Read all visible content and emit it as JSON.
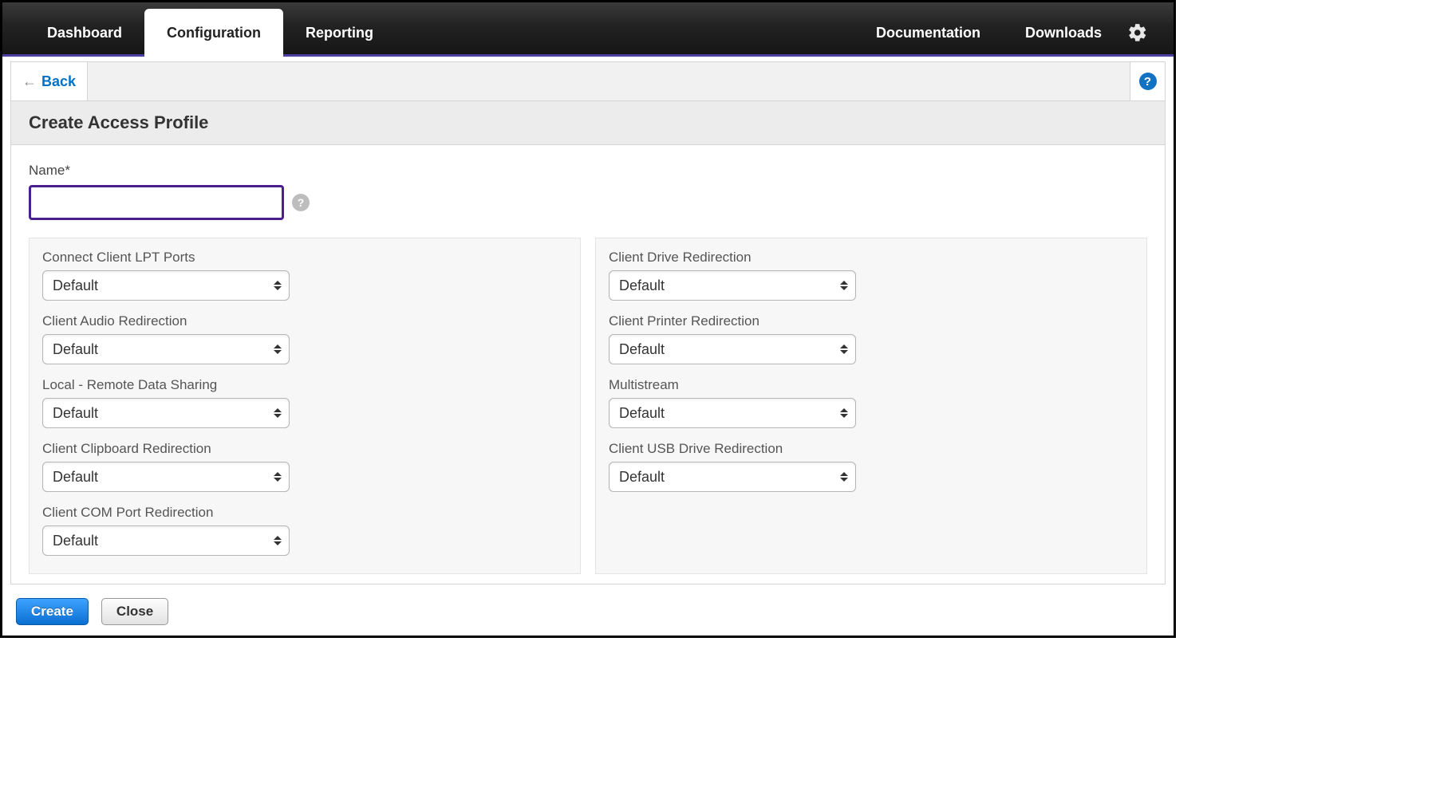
{
  "nav": {
    "tabs": [
      {
        "label": "Dashboard"
      },
      {
        "label": "Configuration"
      },
      {
        "label": "Reporting"
      }
    ],
    "right_tabs": [
      {
        "label": "Documentation"
      },
      {
        "label": "Downloads"
      }
    ],
    "active_index": 1
  },
  "subbar": {
    "back_label": "Back"
  },
  "page": {
    "title": "Create Access Profile"
  },
  "name_field": {
    "label": "Name*",
    "value": ""
  },
  "left_column": [
    {
      "key": "connect_client_lpt_ports",
      "label": "Connect Client LPT Ports",
      "value": "Default"
    },
    {
      "key": "client_audio_redirection",
      "label": "Client Audio Redirection",
      "value": "Default"
    },
    {
      "key": "local_remote_data_sharing",
      "label": "Local - Remote Data Sharing",
      "value": "Default"
    },
    {
      "key": "client_clipboard_redirection",
      "label": "Client Clipboard Redirection",
      "value": "Default"
    },
    {
      "key": "client_com_port_redirection",
      "label": "Client COM Port Redirection",
      "value": "Default"
    }
  ],
  "right_column": [
    {
      "key": "client_drive_redirection",
      "label": "Client Drive Redirection",
      "value": "Default"
    },
    {
      "key": "client_printer_redirection",
      "label": "Client Printer Redirection",
      "value": "Default"
    },
    {
      "key": "multistream",
      "label": "Multistream",
      "value": "Default"
    },
    {
      "key": "client_usb_drive_redirection",
      "label": "Client USB Drive Redirection",
      "value": "Default"
    }
  ],
  "footer": {
    "create_label": "Create",
    "close_label": "Close"
  }
}
